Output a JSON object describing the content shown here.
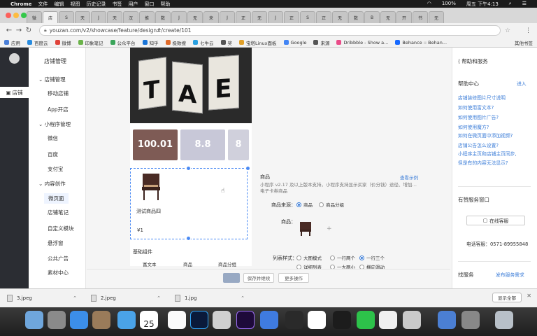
{
  "menubar": {
    "apple": "",
    "app": "Chrome",
    "items": [
      "文件",
      "编辑",
      "视图",
      "历史记录",
      "书签",
      "用户",
      "窗口",
      "帮助"
    ],
    "clock": "周五 下午4:13",
    "battery": "100%"
  },
  "tabs": [
    "微",
    "店",
    "S",
    "天",
    "J",
    "天",
    "汉",
    "推",
    "数",
    "J",
    "无",
    "来",
    "J",
    "正",
    "无",
    "J",
    "正",
    "S",
    "正",
    "无",
    "数",
    "B",
    "无",
    "开",
    "书",
    "无"
  ],
  "address": {
    "url": "youzan.com/v2/showcase/feature/design#/create/101"
  },
  "bookmarks": {
    "items": [
      "应用",
      "百度云",
      "微博",
      "印象笔记",
      "公众平台",
      "知乎",
      "极致搜",
      "七牛云",
      "奖",
      "宝塔Linux面板",
      "Google",
      "来源",
      "Dribbble - Show a...",
      "Behance :: Behan..."
    ],
    "other": "其他书签"
  },
  "nav1": {
    "items": [
      "店铺"
    ]
  },
  "nav2": {
    "header": "店铺管理",
    "groups": [
      "店铺管理",
      "小程序管理",
      "内容创作"
    ],
    "subs": [
      "移动店铺",
      "App开店",
      "微信",
      "百度",
      "支付宝",
      "微页面",
      "店铺笔记",
      "自定义模块",
      "悬浮窗",
      "公共广告",
      "素材中心"
    ],
    "active": "微页面"
  },
  "preview": {
    "book_letters": [
      "T",
      "A",
      "E"
    ],
    "tickets": [
      "100.01",
      "8.8",
      "8"
    ],
    "goods_name": "测试商品四",
    "goods_price": "¥1",
    "basic_title": "基础组件",
    "basic_items": [
      "富文本",
      "商品",
      "商品分组"
    ]
  },
  "editor": {
    "title": "商品",
    "sample_link": "查看示例",
    "hint": "小程序 v2.17 及以上版本支持，小程序支持显示买家（价分钱）途径、增加…",
    "hint2": "电子卡券商品",
    "source_label": "商品来源：",
    "source_options": [
      "商品",
      "商品分组"
    ],
    "goods_label": "商品：",
    "add_symbol": "+",
    "list_label": "列表样式：",
    "list_options": [
      "大图模式",
      "一行两个",
      "一行三个",
      "详细列表",
      "一大两小",
      "横向滑动"
    ],
    "selected_list_option": "一行三个"
  },
  "actions": {
    "publish": "",
    "save_draft": "保存并继续",
    "more": "更多操作"
  },
  "help": {
    "title": "帮助和服务",
    "center": "帮助中心",
    "enter": "进入",
    "links": [
      "店铺装修图片尺寸说明",
      "如何使用富文本?",
      "如何使用图片广告?",
      "如何使用魔方?",
      "如何在微页面中添加视频?",
      "店铺公告怎么设置?",
      "小程序主页和店铺主页同步,",
      "但是有的内容无法显示?"
    ],
    "service_title": "有赞服务窗口",
    "online_service": "在线客服",
    "phone_label": "电话客服：",
    "phone": "0571-89955848",
    "find_service": "找服务",
    "publish_service": "发布服务需求"
  },
  "downloads": {
    "files": [
      "3.jpeg",
      "2.jpeg",
      "1.jpg"
    ],
    "show_all": "显示全部",
    "close": "✕"
  },
  "dock": {
    "calendar_day": "25"
  }
}
